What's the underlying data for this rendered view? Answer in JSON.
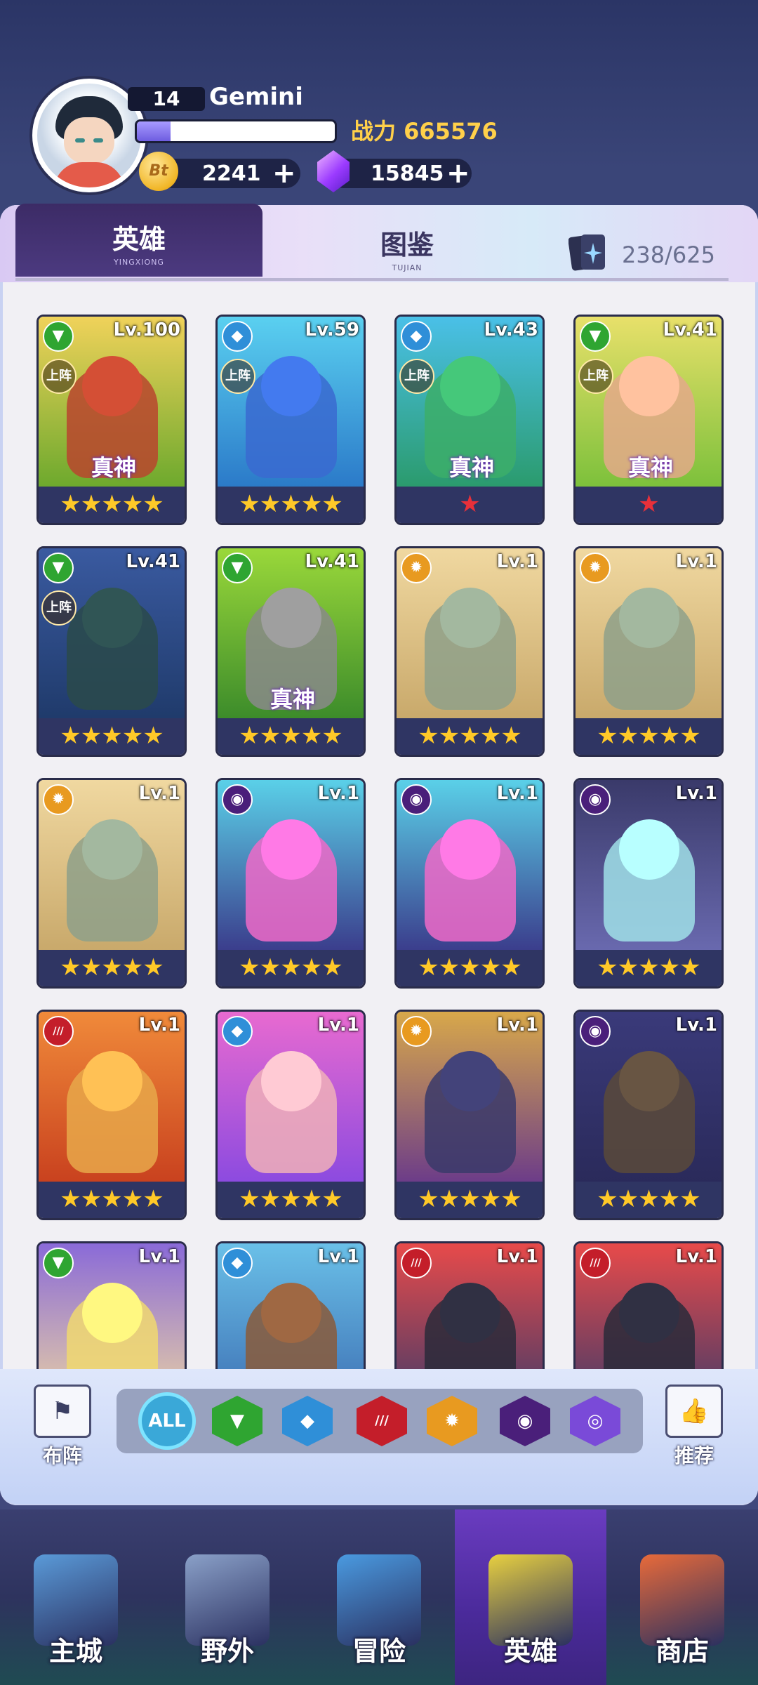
{
  "player": {
    "level": "14",
    "name": "Gemini",
    "xp_progress": 0.17,
    "power_label": "战力 665576",
    "coins": "2241",
    "gems": "15845",
    "coin_symbol": "Bt",
    "plus": "+"
  },
  "tabs": {
    "heroes": {
      "label": "英雄",
      "sub": "YINGXIONG"
    },
    "codex": {
      "label": "图鉴",
      "sub": "TUJIAN"
    },
    "card_count": "238/625"
  },
  "badges": {
    "deploy": "上阵",
    "true_god": "真神"
  },
  "elements": {
    "nature": {
      "color": "#2fa531",
      "glyph": "▼"
    },
    "water": {
      "color": "#2f8fd8",
      "glyph": "◆"
    },
    "fire": {
      "color": "#c41e2a",
      "glyph": "///"
    },
    "light": {
      "color": "#e89a20",
      "glyph": "✹"
    },
    "void": {
      "color": "#4a1f7a",
      "glyph": "◉"
    }
  },
  "heroes": [
    {
      "level": "Lv.100",
      "element": "nature",
      "stars": "★★★★★",
      "star_color": "gold",
      "deployed": true,
      "true_god": true,
      "bg": [
        "#f0d25a",
        "#6aa82c"
      ],
      "tone": "#b8452e"
    },
    {
      "level": "Lv.59",
      "element": "water",
      "stars": "★★★★★",
      "star_color": "gold",
      "deployed": true,
      "true_god": false,
      "bg": [
        "#5ad0f0",
        "#2a78c8"
      ],
      "tone": "#3a6ad0"
    },
    {
      "level": "Lv.43",
      "element": "water",
      "stars": "★",
      "star_color": "red",
      "deployed": true,
      "true_god": true,
      "bg": [
        "#4ac0e8",
        "#2a9a6a"
      ],
      "tone": "#3cae6a"
    },
    {
      "level": "Lv.41",
      "element": "nature",
      "stars": "★",
      "star_color": "red",
      "deployed": true,
      "true_god": true,
      "bg": [
        "#e8e06a",
        "#7ac03a"
      ],
      "tone": "#e4a98a"
    },
    {
      "level": "Lv.41",
      "element": "nature",
      "stars": "★★★★★",
      "star_color": "gold",
      "deployed": true,
      "true_god": false,
      "bg": [
        "#3a5aa0",
        "#1f3a6a"
      ],
      "tone": "#2a4a4a"
    },
    {
      "level": "Lv.41",
      "element": "nature",
      "stars": "★★★★★",
      "star_color": "gold",
      "deployed": false,
      "true_god": true,
      "bg": [
        "#9ad83a",
        "#3a8a2a"
      ],
      "tone": "#8a8a8a"
    },
    {
      "level": "Lv.1",
      "element": "light",
      "stars": "★★★★★",
      "star_color": "gold",
      "deployed": false,
      "true_god": false,
      "bg": [
        "#f0d8a0",
        "#c8a86a"
      ],
      "tone": "#8ea08a"
    },
    {
      "level": "Lv.1",
      "element": "light",
      "stars": "★★★★★",
      "star_color": "gold",
      "deployed": false,
      "true_god": false,
      "bg": [
        "#f0d8a0",
        "#c8a86a"
      ],
      "tone": "#8ea08a"
    },
    {
      "level": "Lv.1",
      "element": "light",
      "stars": "★★★★★",
      "star_color": "gold",
      "deployed": false,
      "true_god": false,
      "bg": [
        "#f0d8a0",
        "#c8a86a"
      ],
      "tone": "#8ea08a"
    },
    {
      "level": "Lv.1",
      "element": "void",
      "stars": "★★★★★",
      "star_color": "gold",
      "deployed": false,
      "true_god": false,
      "bg": [
        "#5ad0e8",
        "#3a3a8a"
      ],
      "tone": "#ee6ac8"
    },
    {
      "level": "Lv.1",
      "element": "void",
      "stars": "★★★★★",
      "star_color": "gold",
      "deployed": false,
      "true_god": false,
      "bg": [
        "#5ad0e8",
        "#3a3a8a"
      ],
      "tone": "#ee6ac8"
    },
    {
      "level": "Lv.1",
      "element": "void",
      "stars": "★★★★★",
      "star_color": "gold",
      "deployed": false,
      "true_god": false,
      "bg": [
        "#3a3a6a",
        "#6a6ab0"
      ],
      "tone": "#a0e0e8"
    },
    {
      "level": "Lv.1",
      "element": "fire",
      "stars": "★★★★★",
      "star_color": "gold",
      "deployed": false,
      "true_god": false,
      "bg": [
        "#f08a3a",
        "#c8401e"
      ],
      "tone": "#e8a84a"
    },
    {
      "level": "Lv.1",
      "element": "water",
      "stars": "★★★★★",
      "star_color": "gold",
      "deployed": false,
      "true_god": false,
      "bg": [
        "#e86ad0",
        "#8a4ae0"
      ],
      "tone": "#f0b0b8"
    },
    {
      "level": "Lv.1",
      "element": "light",
      "stars": "★★★★★",
      "star_color": "gold",
      "deployed": false,
      "true_god": false,
      "bg": [
        "#d8a84a",
        "#6a3a8a"
      ],
      "tone": "#3a3a6a"
    },
    {
      "level": "Lv.1",
      "element": "void",
      "stars": "★★★★★",
      "star_color": "gold",
      "deployed": false,
      "true_god": false,
      "bg": [
        "#3a3a7a",
        "#2a2a5a"
      ],
      "tone": "#5a4a3a"
    },
    {
      "level": "Lv.1",
      "element": "nature",
      "stars": "★★★★★",
      "star_color": "gold",
      "deployed": false,
      "true_god": false,
      "bg": [
        "#8a6ad8",
        "#f0d8a0"
      ],
      "tone": "#f0d870"
    },
    {
      "level": "Lv.1",
      "element": "water",
      "stars": "★★★★★",
      "star_color": "gold",
      "deployed": false,
      "true_god": false,
      "bg": [
        "#6ac0e8",
        "#3a6ab0"
      ],
      "tone": "#8a5a3a"
    },
    {
      "level": "Lv.1",
      "element": "fire",
      "stars": "★★★★★",
      "star_color": "gold",
      "deployed": false,
      "true_god": false,
      "bg": [
        "#e84a4a",
        "#3a3a6a"
      ],
      "tone": "#2a2a3a"
    },
    {
      "level": "Lv.1",
      "element": "fire",
      "stars": "★★★★★",
      "star_color": "gold",
      "deployed": false,
      "true_god": false,
      "bg": [
        "#e84a4a",
        "#3a3a6a"
      ],
      "tone": "#2a2a3a"
    }
  ],
  "filters": {
    "all_label": "ALL",
    "items": [
      {
        "name": "all",
        "color": "#3aa8d8"
      },
      {
        "name": "nature",
        "color": "#2fa531"
      },
      {
        "name": "water",
        "color": "#2f8fd8"
      },
      {
        "name": "fire",
        "color": "#c41e2a"
      },
      {
        "name": "light",
        "color": "#e89a20"
      },
      {
        "name": "void",
        "color": "#4a1f7a"
      },
      {
        "name": "arcane",
        "color": "#7a4ad8"
      }
    ]
  },
  "side_buttons": {
    "deploy": "布阵",
    "recommend": "推荐"
  },
  "nav": [
    {
      "label": "主城",
      "color": "#5a9ad8"
    },
    {
      "label": "野外",
      "color": "#8aa0c8"
    },
    {
      "label": "冒险",
      "color": "#4a9ae0"
    },
    {
      "label": "英雄",
      "color": "#e8d040"
    },
    {
      "label": "商店",
      "color": "#e86a3a"
    }
  ]
}
